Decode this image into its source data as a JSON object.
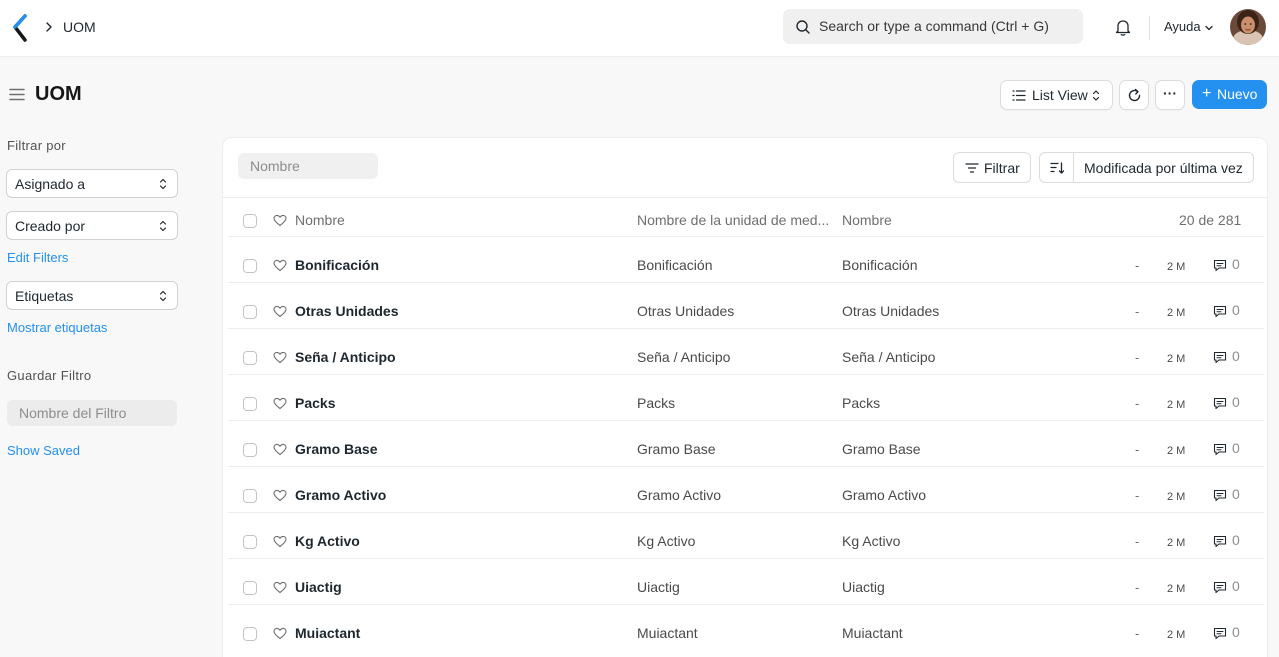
{
  "navbar": {
    "breadcrumb": "UOM",
    "search_placeholder": "Search or type a command (Ctrl + G)",
    "help_label": "Ayuda"
  },
  "page": {
    "title": "UOM",
    "list_view_label": "List View",
    "more_label": "···",
    "new_button_plus": "+",
    "new_button_label": "Nuevo"
  },
  "sidebar": {
    "filter_by": "Filtrar por",
    "assigned_to": "Asignado a",
    "created_by": "Creado por",
    "edit_filters": "Edit Filters",
    "tags": "Etiquetas",
    "show_tags": "Mostrar etiquetas",
    "save_filter": "Guardar Filtro",
    "filter_name_placeholder": "Nombre del Filtro",
    "show_saved": "Show Saved"
  },
  "list": {
    "name_filter_placeholder": "Nombre",
    "filter_button": "Filtrar",
    "sort_label": "Modificada por última vez",
    "headers": {
      "col1": "Nombre",
      "col2": "Nombre de la unidad de med...",
      "col3": "Nombre"
    },
    "count": "20 de 281",
    "rows": [
      {
        "name": "Bonificación",
        "unit_name": "Bonificación",
        "name2": "Bonificación",
        "dash": "-",
        "modified": "2 M",
        "comments": "0"
      },
      {
        "name": "Otras Unidades",
        "unit_name": "Otras Unidades",
        "name2": "Otras Unidades",
        "dash": "-",
        "modified": "2 M",
        "comments": "0"
      },
      {
        "name": "Seña / Anticipo",
        "unit_name": "Seña / Anticipo",
        "name2": "Seña / Anticipo",
        "dash": "-",
        "modified": "2 M",
        "comments": "0"
      },
      {
        "name": "Packs",
        "unit_name": "Packs",
        "name2": "Packs",
        "dash": "-",
        "modified": "2 M",
        "comments": "0"
      },
      {
        "name": "Gramo Base",
        "unit_name": "Gramo Base",
        "name2": "Gramo Base",
        "dash": "-",
        "modified": "2 M",
        "comments": "0"
      },
      {
        "name": "Gramo Activo",
        "unit_name": "Gramo Activo",
        "name2": "Gramo Activo",
        "dash": "-",
        "modified": "2 M",
        "comments": "0"
      },
      {
        "name": "Kg Activo",
        "unit_name": "Kg Activo",
        "name2": "Kg Activo",
        "dash": "-",
        "modified": "2 M",
        "comments": "0"
      },
      {
        "name": "Uiactig",
        "unit_name": "Uiactig",
        "name2": "Uiactig",
        "dash": "-",
        "modified": "2 M",
        "comments": "0"
      },
      {
        "name": "Muiactant",
        "unit_name": "Muiactant",
        "name2": "Muiactant",
        "dash": "-",
        "modified": "2 M",
        "comments": "0"
      }
    ]
  },
  "colors": {
    "primary": "#2490ef",
    "link": "#2490ef"
  }
}
